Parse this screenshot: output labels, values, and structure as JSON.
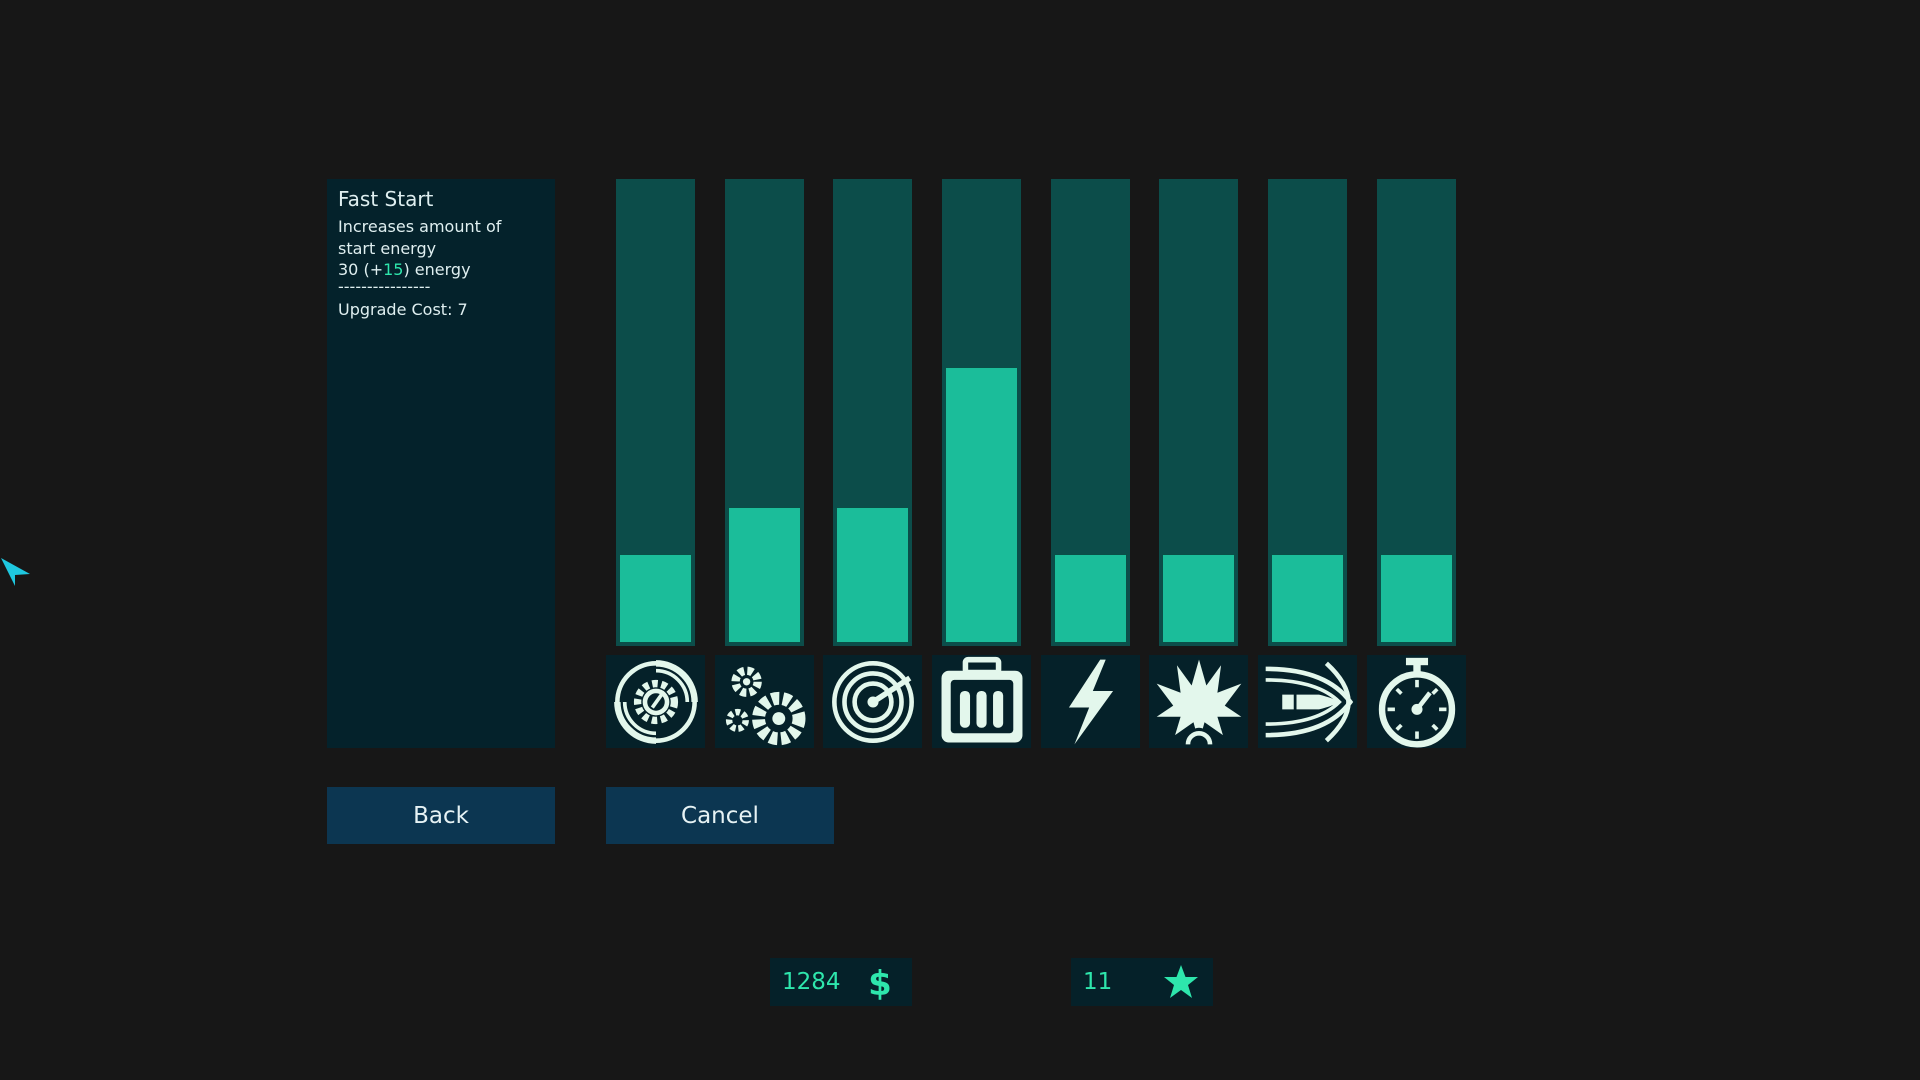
{
  "info_panel": {
    "title": "Fast Start",
    "description": "Increases amount of start energy",
    "stat_prefix": "30 (+",
    "stat_bonus": "15",
    "stat_suffix": ")  energy",
    "separator": "----------------",
    "cost_label": "Upgrade Cost: 7"
  },
  "upgrades": [
    {
      "icon": "vortex-gear-icon",
      "level": 0.2
    },
    {
      "icon": "gears-icon",
      "level": 0.3
    },
    {
      "icon": "radar-icon",
      "level": 0.3
    },
    {
      "icon": "ammo-crate-icon",
      "level": 0.6
    },
    {
      "icon": "lightning-icon",
      "level": 0.2
    },
    {
      "icon": "explosion-icon",
      "level": 0.2
    },
    {
      "icon": "bullet-speed-icon",
      "level": 0.2
    },
    {
      "icon": "stopwatch-icon",
      "level": 0.2
    }
  ],
  "buttons": {
    "back": "Back",
    "cancel": "Cancel"
  },
  "currency": {
    "money": "1284",
    "stars": "11"
  },
  "colors": {
    "background": "#171717",
    "panel": "#04222b",
    "bar_track": "#0c4d4a",
    "bar_fill": "#1bbd9a",
    "button": "#0c3651",
    "accent": "#2ee6ac",
    "icon_fg": "#e3f7ec"
  }
}
